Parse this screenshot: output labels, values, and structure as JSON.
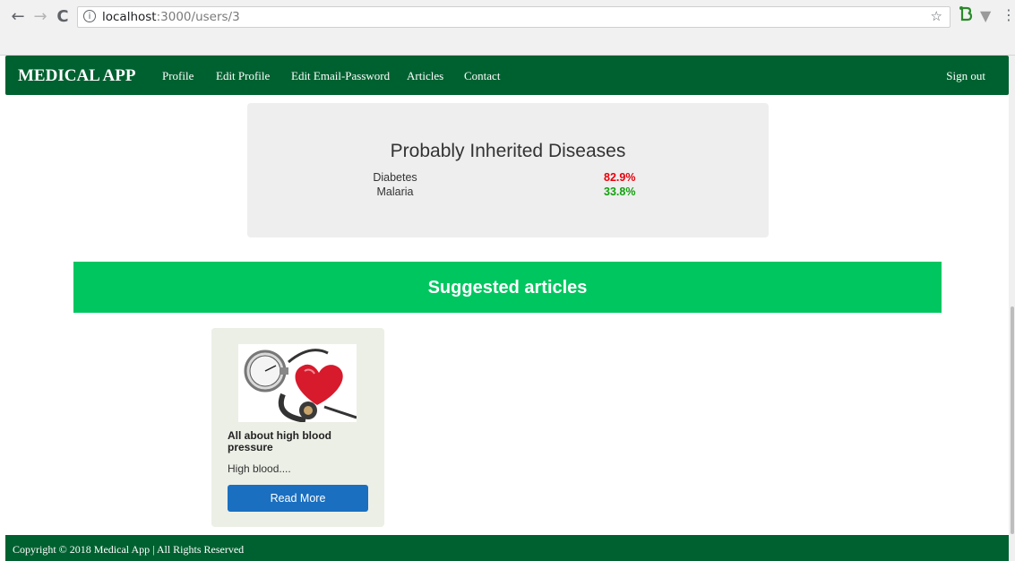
{
  "browser": {
    "url_host": "localhost",
    "url_path": ":3000/users/3",
    "info_icon": "i",
    "star_icon": "☆"
  },
  "navbar": {
    "brand": "MEDICAL APP",
    "links": [
      "Profile",
      "Edit Profile",
      "Edit Email-Password",
      "Articles",
      "Contact"
    ],
    "signout": "Sign out"
  },
  "diseases": {
    "title": "Probably Inherited Diseases",
    "items": [
      {
        "name": "Diabetes",
        "percent": "82.9%",
        "color": "#e8000b"
      },
      {
        "name": "Malaria",
        "percent": "33.8%",
        "color": "#13a10e"
      }
    ]
  },
  "suggested": {
    "title": "Suggested articles"
  },
  "article": {
    "title": "All about high blood pressure",
    "excerpt": "High blood....",
    "button": "Read More",
    "image_icon": "blood-pressure-heart-image"
  },
  "footer": {
    "text": "Copyright © 2018 Medical App | All Rights Reserved"
  },
  "colors": {
    "nav_green": "#006130",
    "banner_green": "#00c660",
    "button_blue": "#1a6fc0"
  }
}
